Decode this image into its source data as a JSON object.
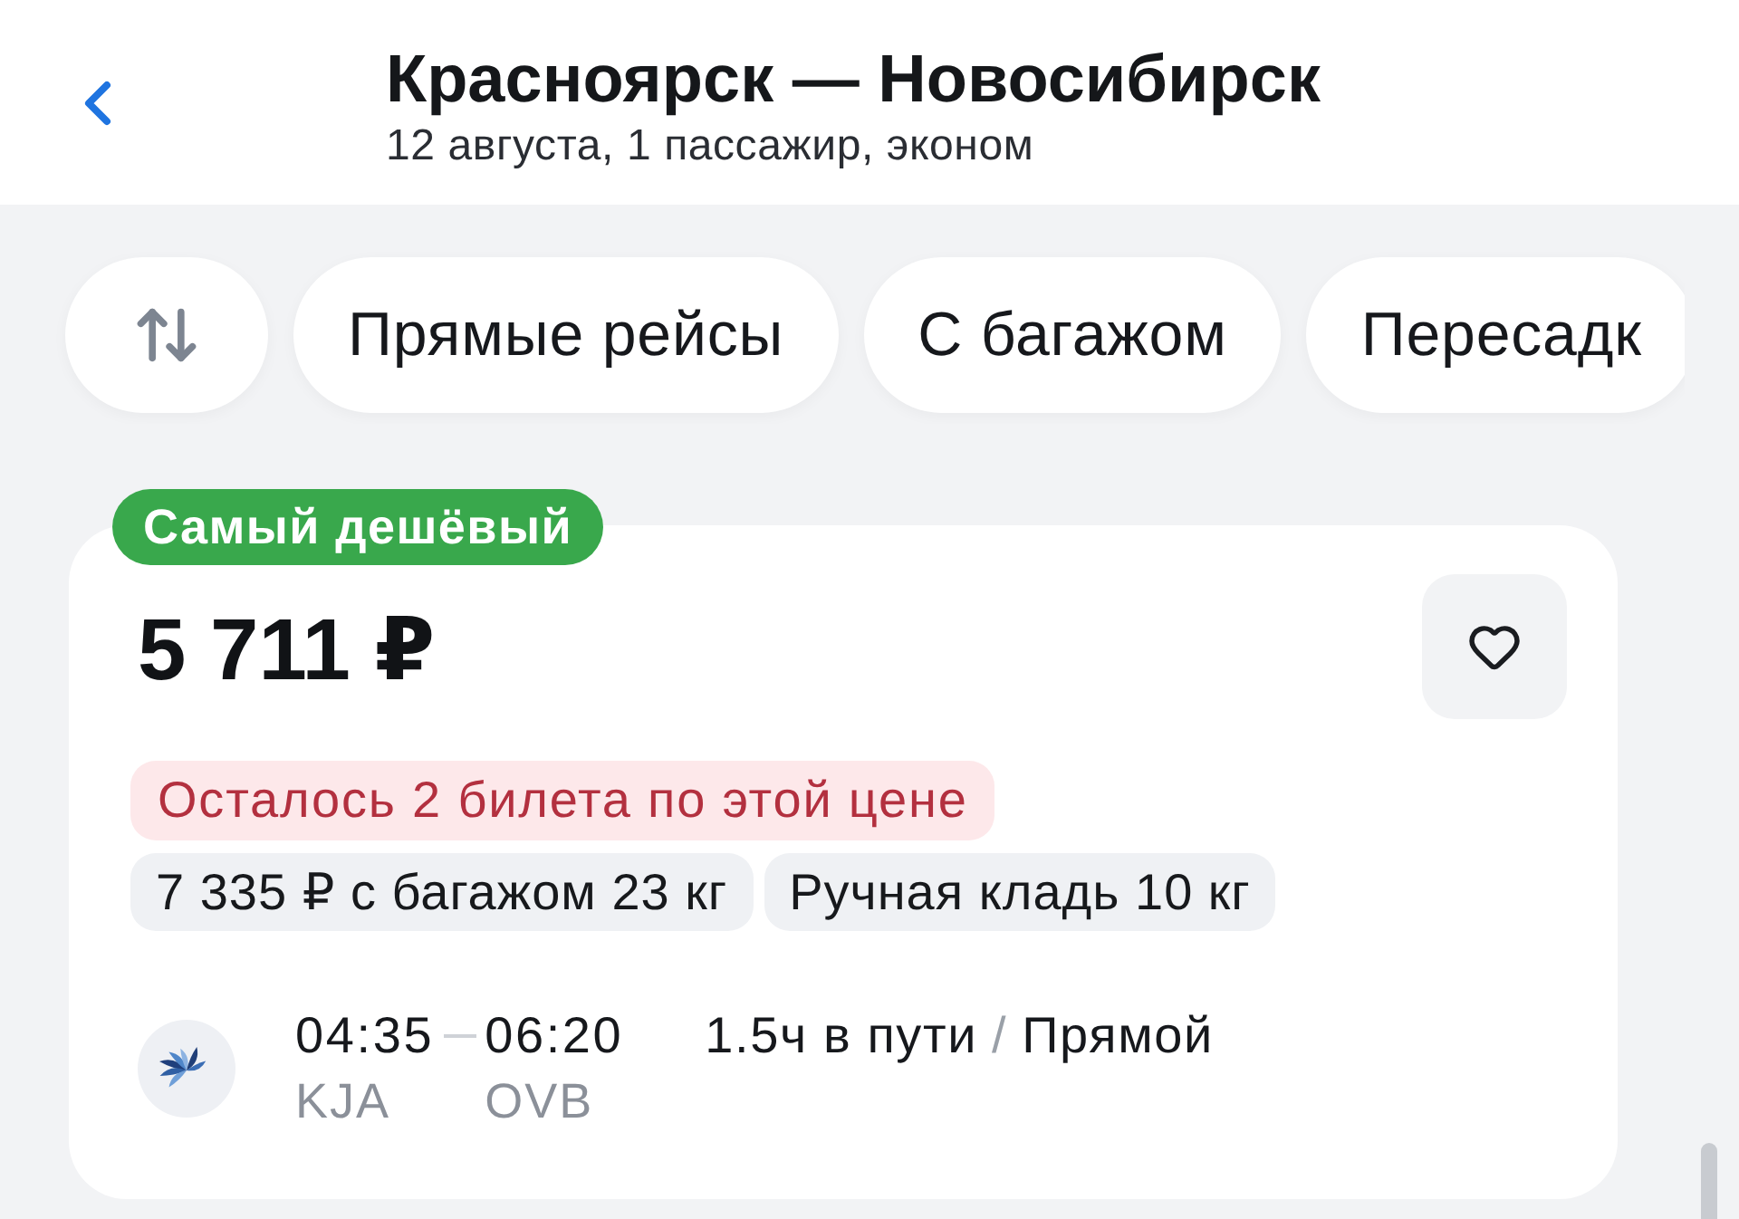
{
  "header": {
    "title": "Красноярск — Новосибирск",
    "subtitle": "12 августа, 1 пассажир, эконом"
  },
  "filters": [
    {
      "label": "Прямые рейсы",
      "selected": false
    },
    {
      "label": "С багажом",
      "selected": false
    },
    {
      "label": "Пересадк",
      "selected": false
    }
  ],
  "offer": {
    "badge": "Самый дешёвый",
    "price": "5 711 ₽",
    "favorite": false,
    "availability": "Осталось 2 билета по этой цене",
    "tags": [
      "7 335 ₽ с багажом 23 кг",
      "Ручная кладь 10 кг"
    ],
    "flight": {
      "departure_time": "04:35",
      "arrival_time": "06:20",
      "departure_airport": "KJA",
      "arrival_airport": "OVB",
      "duration": "1.5ч в пути",
      "separator": "/",
      "stops": "Прямой"
    }
  }
}
